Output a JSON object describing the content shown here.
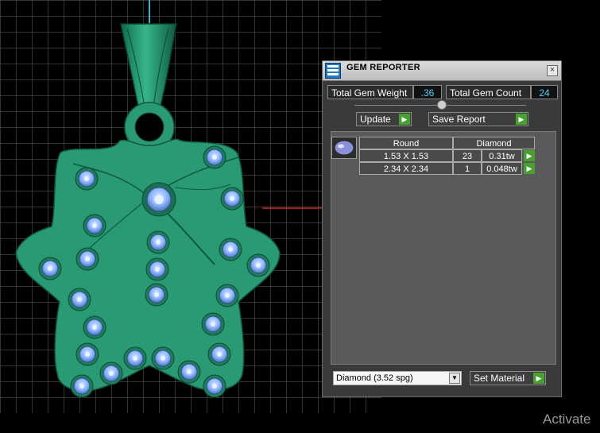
{
  "gem_reporter": {
    "title": "GEM REPORTER",
    "close": "×",
    "total_weight_label": "Total Gem Weight",
    "total_weight_value": ".36",
    "total_count_label": "Total Gem Count",
    "total_count_value": "24",
    "update_label": "Update",
    "save_report_label": "Save Report",
    "table": {
      "headers": [
        "Round",
        "Diamond"
      ],
      "rows": [
        {
          "size": "1.53 X 1.53",
          "count": "23",
          "weight": "0.31tw"
        },
        {
          "size": "2.34 X 2.34",
          "count": "1",
          "weight": "0.048tw"
        }
      ]
    },
    "material_value": "Diamond     (3.52 spg)",
    "set_material_label": "Set Material"
  },
  "activate_text": "Activate",
  "colors": {
    "pendant": "#2a9a74",
    "gem": "#86b7ff",
    "grid": "#7b7b7b",
    "arrow": "#47a12f"
  }
}
